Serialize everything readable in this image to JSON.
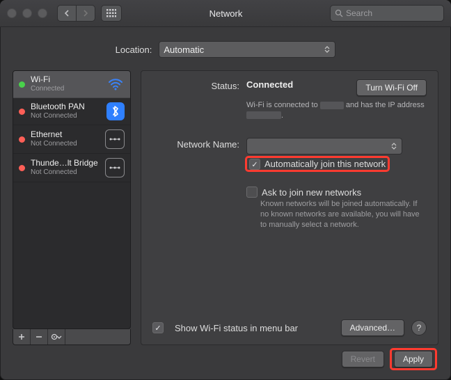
{
  "titlebar": {
    "title": "Network",
    "search_placeholder": "Search"
  },
  "location": {
    "label": "Location:",
    "value": "Automatic"
  },
  "sidebar": {
    "items": [
      {
        "name": "Wi-Fi",
        "status": "Connected",
        "dot": "green",
        "icon": "wifi"
      },
      {
        "name": "Bluetooth PAN",
        "status": "Not Connected",
        "dot": "red",
        "icon": "bluetooth"
      },
      {
        "name": "Ethernet",
        "status": "Not Connected",
        "dot": "red",
        "icon": "ethernet"
      },
      {
        "name": "Thunde…lt Bridge",
        "status": "Not Connected",
        "dot": "red",
        "icon": "ethernet"
      }
    ]
  },
  "main": {
    "status_label": "Status:",
    "status_value": "Connected",
    "turn_off": "Turn Wi-Fi Off",
    "desc_a": "Wi-Fi is connected to",
    "desc_b": "and has the IP address",
    "desc_c": ".",
    "network_name_label": "Network Name:",
    "network_name_value": "",
    "auto_join": "Automatically join this network",
    "ask_join": "Ask to join new networks",
    "ask_hint": "Known networks will be joined automatically. If no known networks are available, you will have to manually select a network.",
    "show_menu": "Show Wi-Fi status in menu bar",
    "advanced": "Advanced…"
  },
  "footer": {
    "revert": "Revert",
    "apply": "Apply"
  }
}
